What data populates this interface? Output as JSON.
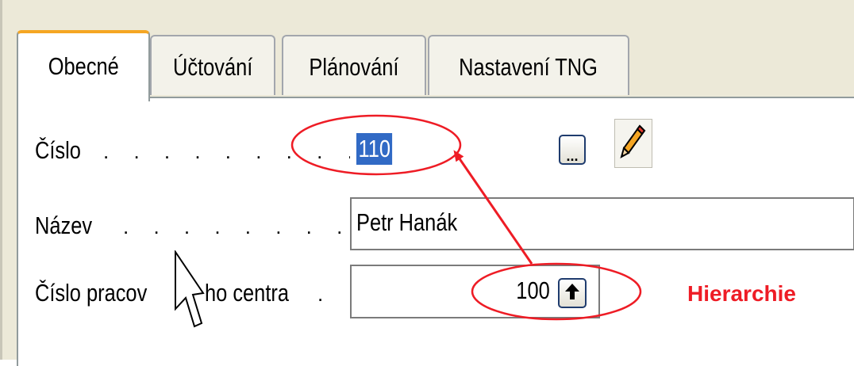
{
  "tabs": [
    {
      "label": "Obecné",
      "active": true
    },
    {
      "label": "Účtování",
      "active": false
    },
    {
      "label": "Plánování",
      "active": false
    },
    {
      "label": "Nastavení TNG",
      "active": false
    }
  ],
  "fields": {
    "number": {
      "label": "Číslo",
      "value": "110",
      "selected": true
    },
    "name": {
      "label": "Název",
      "value": "Petr Hanák"
    },
    "work_center_number": {
      "label": "Číslo pracov",
      "label_tail": "ho centra",
      "value": "100"
    }
  },
  "buttons": {
    "lookup_label": "...",
    "edit_icon": "pencil-icon",
    "parent_icon": "up-arrow-icon"
  },
  "annotation": {
    "text": "Hierarchie",
    "color": "#ee1c25"
  },
  "colors": {
    "active_tab_accent": "#f5a623",
    "selection": "#316ac5",
    "field_border": "#7f9db9"
  }
}
